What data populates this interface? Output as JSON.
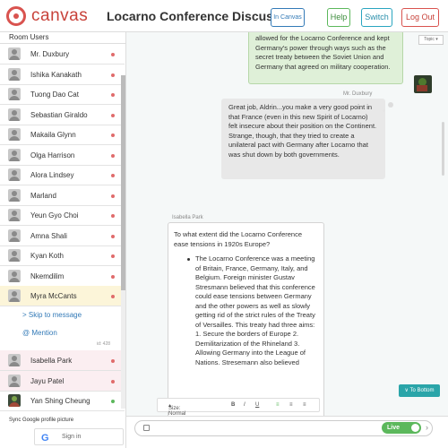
{
  "app": {
    "logo_text": "canvas",
    "room_title": "Locarno Conference Discussion"
  },
  "header": {
    "in_canvas": "In Canvas",
    "help": "Help",
    "switch": "Switch",
    "logout": "Log Out"
  },
  "sidebar": {
    "heading": "Room Users",
    "users": [
      {
        "name": "Mr. Duxbury",
        "status": "away"
      },
      {
        "name": "Ishika Kanakath",
        "status": "away"
      },
      {
        "name": "Tuong Dao Cat",
        "status": "away"
      },
      {
        "name": "Sebastian Giraldo",
        "status": "away"
      },
      {
        "name": "Makaila Glynn",
        "status": "away"
      },
      {
        "name": "Olga Harrison",
        "status": "away"
      },
      {
        "name": "Alora Lindsey",
        "status": "away"
      },
      {
        "name": "Marland",
        "status": "away"
      },
      {
        "name": "Yeun Gyo Choi",
        "status": "away"
      },
      {
        "name": "Amna Shali",
        "status": "away"
      },
      {
        "name": "Kyan Koth",
        "status": "away"
      },
      {
        "name": "Nkemdilim",
        "status": "away"
      },
      {
        "name": "Myra McCants",
        "status": "away"
      }
    ],
    "skip_link": "Skip to message",
    "mention_link": "Mention",
    "count_text": "id: 428",
    "lower_users": [
      {
        "name": "Isabella Park",
        "status": "away"
      },
      {
        "name": "Jayu Patel",
        "status": "away"
      },
      {
        "name": "Yan Shing Cheung",
        "status": "online"
      }
    ],
    "sync_text": "Sync Google profile picture",
    "signin_label": "Sign in"
  },
  "chat": {
    "topic_btn": "Topic",
    "msg_green": "allowed for the Locarno Conference and kept Germany's power through ways such as the secret treaty between the Soviet Union and Germany that agreed on military cooperation.",
    "sender_duxbury": "Mr. Duxbury",
    "msg_duxbury": "Great job, Aldrin...you make a very good point in that France (even in this new Spirit of Locarno) felt insecure about their position on the Continent. Strange, though, that they tried to create a unilateral pact with Germany after Locarno that was shut down by both governments.",
    "sender_isabella": "Isabella Park",
    "question": "To what extent did the Locarno Conference ease tensions in 1920s Europe?",
    "answer": "The Locarno Conference was a meeting of Britain, France, Germany, Italy, and Belgium. Foreign minister Gustav Stresmann believed that this conference could ease tensions between Germany and the other powers as well as slowly getting rid of the strict rules of the Treaty of Versailles. This treaty had three aims: 1. Secure the borders of Europe 2. Demilitarization of the Rhineland 3. Allowing Germany into the League of Nations. Stresemann also believed",
    "toolbar": {
      "size": "Size: Normal",
      "bold": "B",
      "italic": "I",
      "underline": "U"
    },
    "to_bottom": "∨ To Bottom"
  },
  "inputbar": {
    "live": "Live",
    "arrow": "›"
  }
}
